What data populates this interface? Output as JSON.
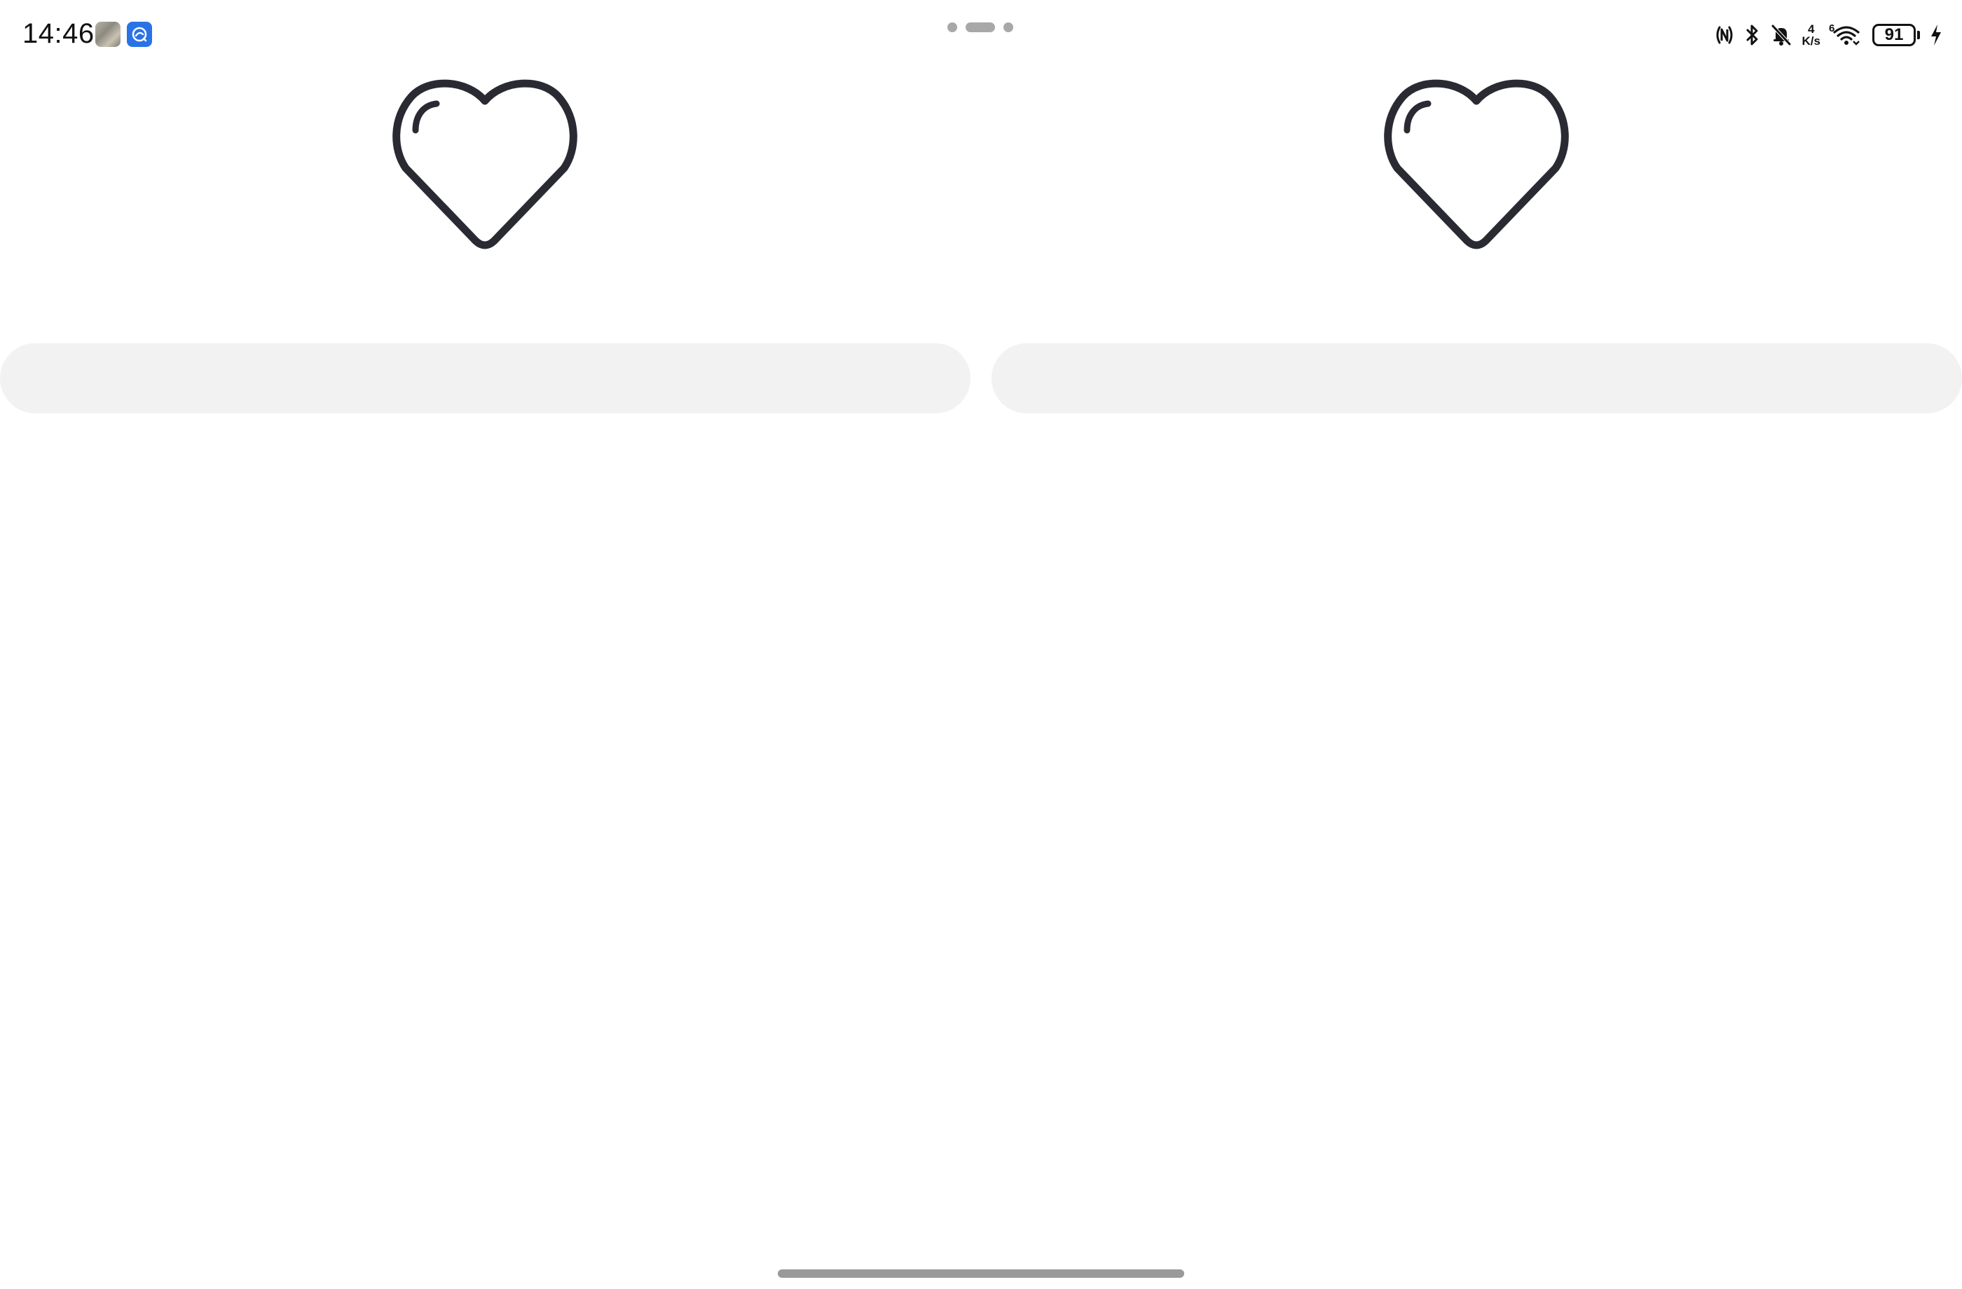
{
  "status_bar": {
    "time": "14:46",
    "notification_icons": [
      "gallery-app-icon",
      "browser-app-icon"
    ],
    "net_speed_value": "4",
    "net_speed_unit": "K/s",
    "wifi_generation": "6",
    "battery_level": "91",
    "charging": true,
    "status_icons": [
      "nfc-icon",
      "bluetooth-icon",
      "bell-muted-icon",
      "net-speed",
      "wifi-icon",
      "battery-icon",
      "charging-bolt-icon"
    ]
  },
  "multiwindow": {
    "handle_icon": "window-handle-icon"
  },
  "panes": [
    {
      "name": "left",
      "icon": "heart-icon",
      "bar": ""
    },
    {
      "name": "right",
      "icon": "heart-icon",
      "bar": ""
    }
  ],
  "colors": {
    "icon_stroke": "#2a2a33",
    "bar_fill": "#f2f2f2",
    "background": "#ffffff",
    "browser_icon": "#2a73e6"
  }
}
